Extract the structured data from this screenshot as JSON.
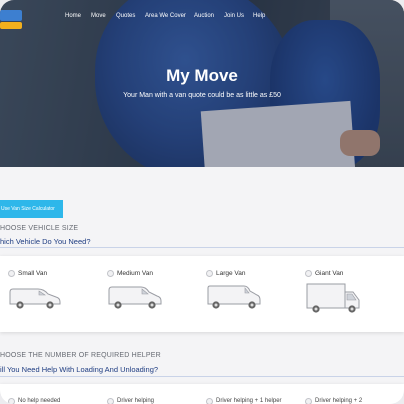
{
  "nav": {
    "items": [
      "Home",
      "Move",
      "Quotes",
      "Area We Cover",
      "Auction",
      "Join Us",
      "Help"
    ]
  },
  "hero": {
    "title": "My Move",
    "subtitle": "Your Man with a van quote could be as little as £50"
  },
  "calculator_button": "Use Van Size Calculator",
  "vehicle_section": {
    "label": "HOOSE VEHICLE SIZE",
    "question": "hich Vehicle Do You Need?",
    "options": [
      {
        "label": "Small Van",
        "icon": "small-van-icon"
      },
      {
        "label": "Medium Van",
        "icon": "medium-van-icon"
      },
      {
        "label": "Large Van",
        "icon": "large-van-icon"
      },
      {
        "label": "Giant Van",
        "icon": "giant-van-icon"
      }
    ]
  },
  "helper_section": {
    "label": "HOOSE THE NUMBER OF REQUIRED HELPER",
    "question": "ill You Need Help With Loading And Unloading?",
    "options": [
      "No help needed",
      "Driver helping",
      "Driver helping + 1 helper",
      "Driver helping + 2"
    ]
  },
  "colors": {
    "accent": "#2eb7ea",
    "question_text": "#1f3d82",
    "logo_blue": "#3d7fd0",
    "logo_yellow": "#f2b01e"
  }
}
